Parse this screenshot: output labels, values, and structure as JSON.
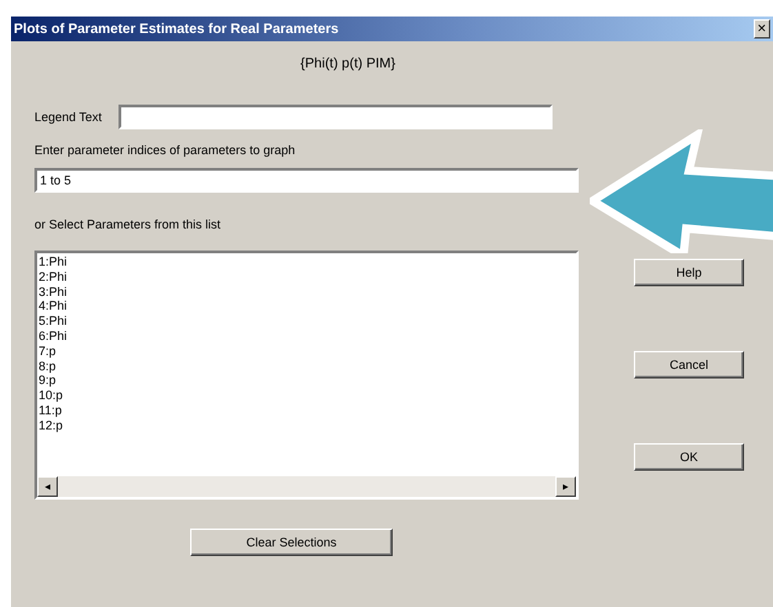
{
  "window": {
    "title": "Plots of Parameter Estimates for Real Parameters",
    "close": "×"
  },
  "subtitle": "{Phi(t) p(t) PIM}",
  "legend": {
    "label": "Legend Text"
  },
  "indices": {
    "label": "Enter parameter indices of parameters to graph",
    "value": "1 to 5"
  },
  "list_label": "or Select Parameters from this list",
  "parameters": [
    {
      "label": "1:Phi",
      "selected": false
    },
    {
      "label": "2:Phi",
      "selected": false
    },
    {
      "label": "3:Phi",
      "selected": false
    },
    {
      "label": "4:Phi",
      "selected": false
    },
    {
      "label": "5:Phi",
      "selected": false
    },
    {
      "label": "6:Phi",
      "selected": false
    },
    {
      "label": "7:p",
      "selected": false
    },
    {
      "label": "8:p",
      "selected": false
    },
    {
      "label": "9:p",
      "selected": false
    },
    {
      "label": "10:p",
      "selected": false
    },
    {
      "label": "11:p",
      "selected": false
    },
    {
      "label": "12:p",
      "selected": false
    }
  ],
  "scroll_left": "◂",
  "scroll_right": "▸",
  "side_buttons": [
    "Help",
    "Cancel",
    "OK"
  ],
  "clear_button": "Clear Selections"
}
